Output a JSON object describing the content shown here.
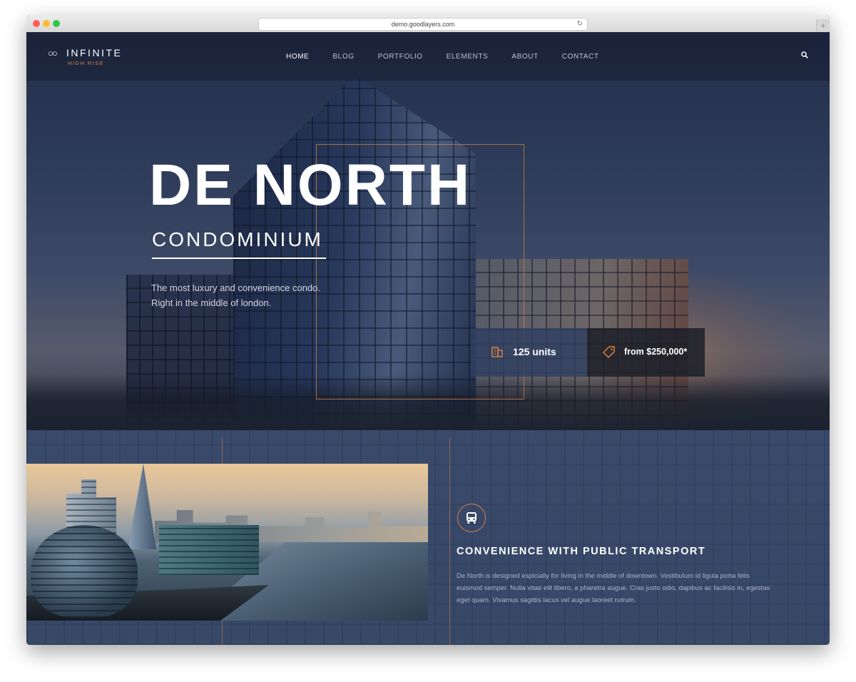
{
  "browser": {
    "url": "demo.goodlayers.com"
  },
  "logo": {
    "name": "INFINITE",
    "tagline": "HIGH RISE"
  },
  "nav": {
    "items": [
      {
        "label": "HOME",
        "active": true
      },
      {
        "label": "BLOG",
        "active": false
      },
      {
        "label": "PORTFOLIO",
        "active": false
      },
      {
        "label": "ELEMENTS",
        "active": false
      },
      {
        "label": "ABOUT",
        "active": false
      },
      {
        "label": "CONTACT",
        "active": false
      }
    ],
    "search_icon": "search-icon"
  },
  "hero": {
    "title": "DE NORTH",
    "subtitle": "CONDOMINIUM",
    "tagline_lines": [
      "The most luxury and convenience condo.",
      "Right in the middle of london."
    ],
    "stats": [
      {
        "label": "125 units",
        "icon": "building-icon"
      },
      {
        "label": "from $250,000*",
        "icon": "price-tag-icon"
      }
    ]
  },
  "feature": {
    "icon": "bus-icon",
    "title": "CONVENIENCE WITH PUBLIC TRANSPORT",
    "text_lines": [
      "De North is designed espicially for living in the middle of downtown. Vestibulum id ligula porta felis",
      "euismod semper. Nulla vitae elit libero, a pharetra augue. Cras justo odio, dapibus ac facilisis in, egestas",
      "eget quam. Vivamus sagittis lacus vel augue laoreet rutrum."
    ]
  },
  "colors": {
    "accent": "#d8813f",
    "nav_bg": "#161e32",
    "section_bg": "#354564",
    "text_muted": "#aab3c6"
  }
}
